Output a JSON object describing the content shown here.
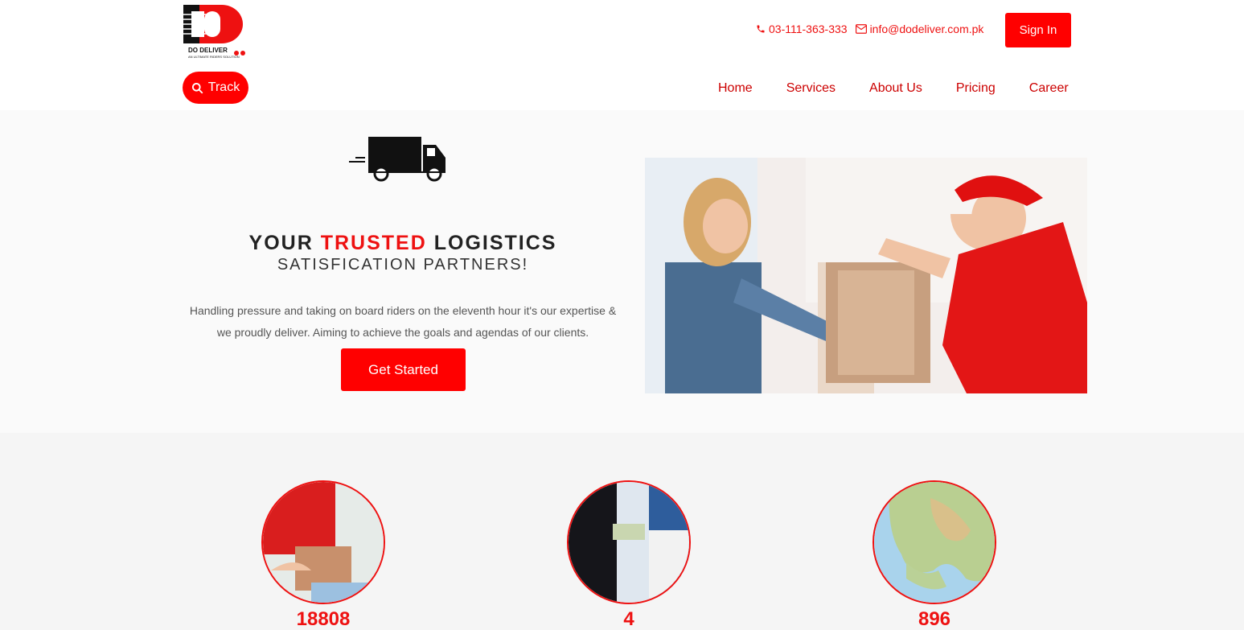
{
  "logo": {
    "text": "DO DELIVER",
    "tagline": "AN ULTIMATE RIDERS SOLUTION"
  },
  "contact": {
    "phone": "03-111-363-333",
    "email": "info@dodeliver.com.pk"
  },
  "signin_label": "Sign In",
  "track_label": "Track",
  "nav": [
    "Home",
    "Services",
    "About Us",
    "Pricing",
    "Career"
  ],
  "hero": {
    "headline_1": "YOUR ",
    "headline_red": "TRUSTED",
    "headline_2": " LOGISTICS",
    "subhead": "SATISFICATION PARTNERS!",
    "paragraph": "Handling pressure and taking on board riders on the eleventh hour it's our expertise & we proudly deliver. Aiming to achieve the goals and agendas of our clients.",
    "cta": "Get Started"
  },
  "stats": [
    {
      "value": "18808"
    },
    {
      "value": "4"
    },
    {
      "value": "896"
    }
  ],
  "colors": {
    "brand": "#ff0000",
    "text": "#222222",
    "background": "#fafafa"
  }
}
